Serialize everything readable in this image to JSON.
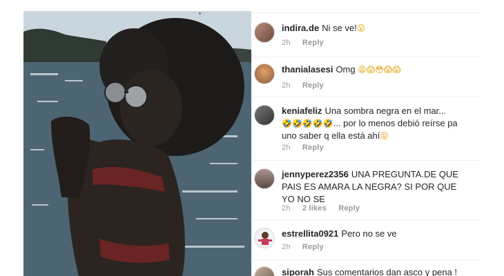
{
  "post": {
    "photo_alt": "photo"
  },
  "comments": [
    {
      "username": "indira.de",
      "text": "Ni se ve!",
      "emoji": "😮",
      "time": "2h",
      "likes": "",
      "reply_label": "Reply",
      "avatar_color": "#9b6b5a"
    },
    {
      "username": "thanialasesi",
      "text": "Omg",
      "emoji": "😩😱😳😱😱",
      "time": "2h",
      "likes": "",
      "reply_label": "Reply",
      "avatar_color": "#c98a5a"
    },
    {
      "username": "keniafeliz",
      "text": "Una sombra negra en el mar...",
      "emoji": "🤣🤣🤣🤣🤣",
      "text2": "... por lo menos debió reírse pa uno saber q ella está ahí",
      "emoji2": "😝",
      "time": "2h",
      "likes": "",
      "reply_label": "Reply",
      "avatar_color": "#555555"
    },
    {
      "username": "jennyperez2356",
      "text": "UNA PREGUNTA.DE QUE PAIS ES AMARA LA NEGRA? SI POR QUE YO NO SE",
      "time": "2h",
      "likes": "2 likes",
      "reply_label": "Reply",
      "avatar_color": "#7a6a66"
    },
    {
      "username": "estrellita0921",
      "text": "Pero no se ve",
      "time": "2h",
      "likes": "",
      "reply_label": "Reply",
      "avatar_color": "#d9d9d9"
    },
    {
      "username": "siporah",
      "text": "Sus comentarios dan asco y pena !",
      "time": "",
      "likes": "",
      "reply_label": "",
      "avatar_color": "#9a8a7a"
    }
  ],
  "colors": {
    "username": "#262626",
    "meta": "#999999",
    "separator": "#efefef"
  }
}
